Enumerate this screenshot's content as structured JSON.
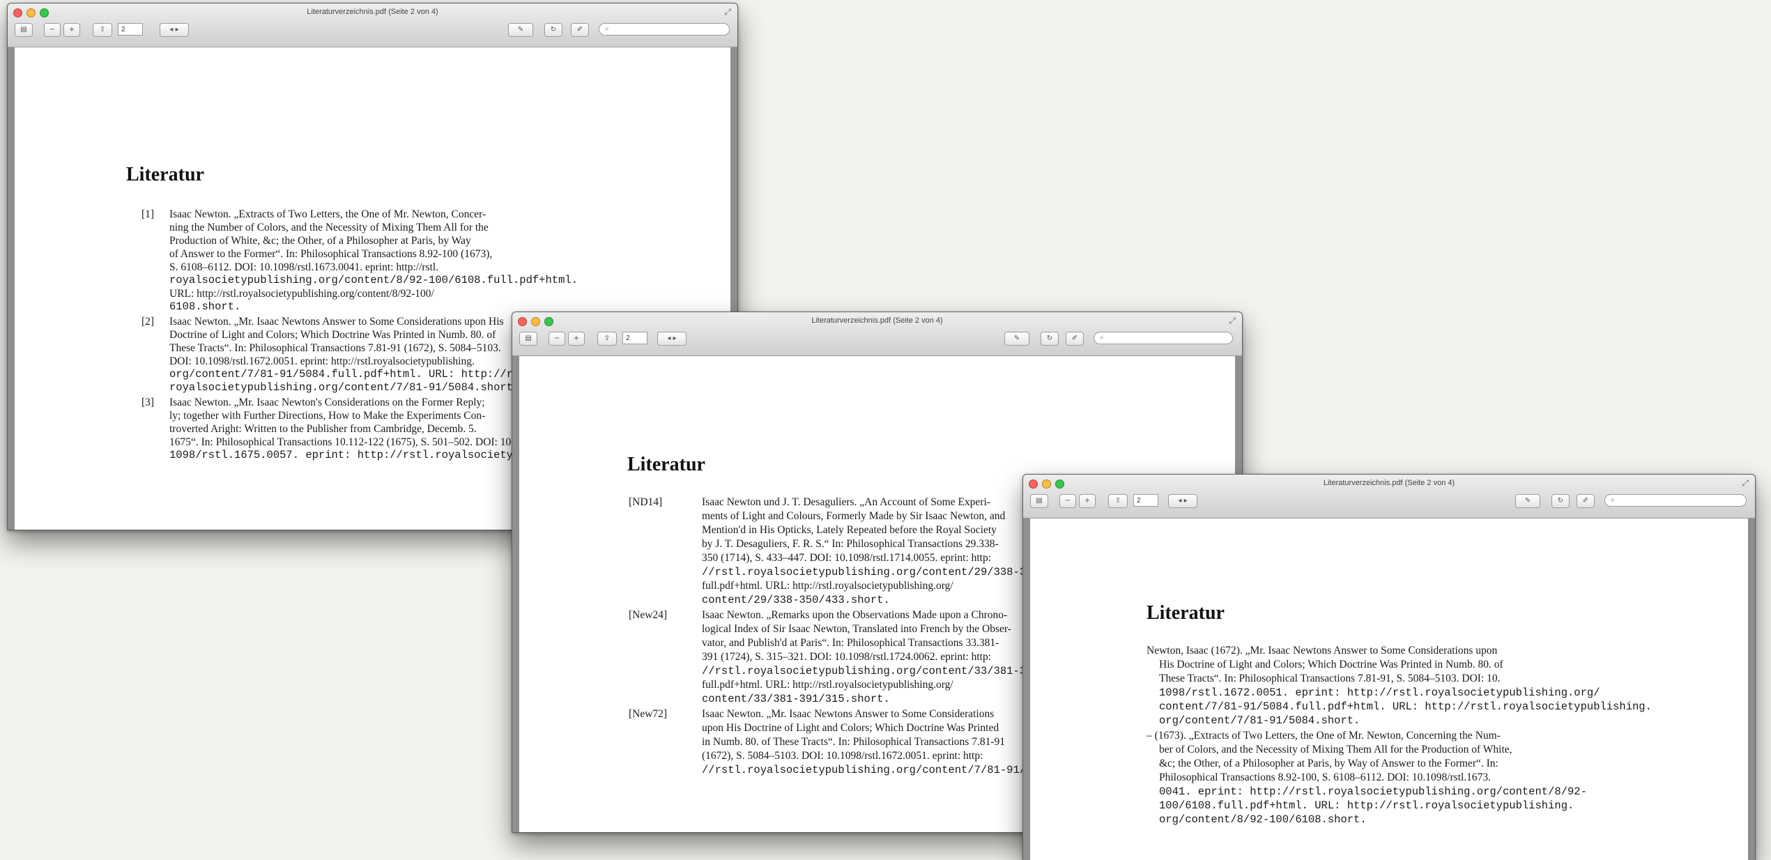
{
  "windows": [
    {
      "title": "Literaturverzeichnis.pdf (Seite 2 von 4)",
      "page_number": "2",
      "heading": "Literatur",
      "entries": [
        {
          "label": "[1]",
          "lines": [
            "Isaac Newton. „Extracts of Two Letters, the One of Mr. Newton, Concer-",
            "ning the Number of Colors, and the Necessity of Mixing Them All for the",
            "Production of White, &c; the Other, of a Philosopher at Paris, by Way",
            "of Answer to the Former“. In: Philosophical Transactions 8.92-100 (1673),",
            "S. 6108–6112. DOI: 10.1098/rstl.1673.0041. eprint: http://rstl.",
            "royalsocietypublishing.org/content/8/92-100/6108.full.pdf+html.",
            "URL: http://rstl.royalsocietypublishing.org/content/8/92-100/",
            "6108.short."
          ]
        },
        {
          "label": "[2]",
          "lines": [
            "Isaac Newton. „Mr. Isaac Newtons Answer to Some Considerations upon His",
            "Doctrine of Light and Colors; Which Doctrine Was Printed in Numb. 80. of",
            "These Tracts“. In: Philosophical Transactions 7.81-91 (1672), S. 5084–5103.",
            "DOI: 10.1098/rstl.1672.0051. eprint: http://rstl.royalsocietypublishing.",
            "org/content/7/81-91/5084.full.pdf+html. URL: http://rstl.",
            "royalsocietypublishing.org/content/7/81-91/5084.short."
          ]
        },
        {
          "label": "[3]",
          "lines": [
            "Isaac Newton. „Mr. Isaac Newton's Considerations on the Former Reply;",
            "ly; together with Further Directions, How to Make the Experiments Con-",
            "troverted Aright: Written to the Publisher from Cambridge, Decemb. 5.",
            "1675“. In: Philosophical Transactions 10.112-122 (1675), S. 501–502. DOI: 10.",
            "1098/rstl.1675.0057. eprint: http://rstl.royalsocietypublishing."
          ]
        }
      ]
    },
    {
      "title": "Literaturverzeichnis.pdf (Seite 2 von 4)",
      "page_number": "2",
      "heading": "Literatur",
      "entries": [
        {
          "label": "[ND14]",
          "lines": [
            "Isaac Newton und J. T. Desaguliers. „An Account of Some Experi-",
            "ments of Light and Colours, Formerly Made by Sir Isaac Newton, and",
            "Mention'd in His Opticks, Lately Repeated before the Royal Society",
            "by J. T. Desaguliers, F. R. S.“ In: Philosophical Transactions 29.338-",
            "350 (1714), S. 433–447. DOI: 10.1098/rstl.1714.0055. eprint: http:",
            "//rstl.royalsocietypublishing.org/content/29/338-350/433.",
            "full.pdf+html. URL: http://rstl.royalsocietypublishing.org/",
            "content/29/338-350/433.short."
          ]
        },
        {
          "label": "[New24]",
          "lines": [
            "Isaac Newton. „Remarks upon the Observations Made upon a Chrono-",
            "logical Index of Sir Isaac Newton, Translated into French by the Obser-",
            "vator, and Publish'd at Paris“. In: Philosophical Transactions 33.381-",
            "391 (1724), S. 315–321. DOI: 10.1098/rstl.1724.0062. eprint: http:",
            "//rstl.royalsocietypublishing.org/content/33/381-391/315.",
            "full.pdf+html. URL: http://rstl.royalsocietypublishing.org/",
            "content/33/381-391/315.short."
          ]
        },
        {
          "label": "[New72]",
          "lines": [
            "Isaac Newton. „Mr. Isaac Newtons Answer to Some Considerations",
            "upon His Doctrine of Light and Colors; Which Doctrine Was Printed",
            "in Numb. 80. of These Tracts“. In: Philosophical Transactions 7.81-91",
            "(1672), S. 5084–5103. DOI: 10.1098/rstl.1672.0051. eprint: http:",
            "//rstl.royalsocietypublishing.org/content/7/81-91/5084."
          ]
        }
      ]
    },
    {
      "title": "Literaturverzeichnis.pdf (Seite 2 von 4)",
      "page_number": "2",
      "heading": "Literatur",
      "entries": [
        {
          "label": "",
          "lines": [
            "Newton, Isaac (1672). „Mr. Isaac Newtons Answer to Some Considerations upon",
            "His Doctrine of Light and Colors; Which Doctrine Was Printed in Numb. 80. of",
            "These Tracts“. In: Philosophical Transactions 7.81-91, S. 5084–5103. DOI: 10.",
            "1098/rstl.1672.0051. eprint: http://rstl.royalsocietypublishing.org/",
            "content/7/81-91/5084.full.pdf+html. URL: http://rstl.royalsocietypublishing.",
            "org/content/7/81-91/5084.short."
          ]
        },
        {
          "label": "",
          "lines": [
            "– (1673). „Extracts of Two Letters, the One of Mr. Newton, Concerning the Num-",
            "ber of Colors, and the Necessity of Mixing Them All for the Production of White,",
            "&c; the Other, of a Philosopher at Paris, by Way of Answer to the Former“. In:",
            "Philosophical Transactions 8.92-100, S. 6108–6112. DOI: 10.1098/rstl.1673.",
            "0041. eprint: http://rstl.royalsocietypublishing.org/content/8/92-",
            "100/6108.full.pdf+html. URL: http://rstl.royalsocietypublishing.",
            "org/content/8/92-100/6108.short."
          ]
        }
      ]
    }
  ],
  "icons": {
    "sidebar": "sidebar-icon",
    "zoom_out": "zoom-out-icon",
    "zoom_in": "zoom-in-icon",
    "share": "share-icon",
    "prev_next": "prev-next-icon",
    "annotate": "pencil-icon",
    "rotate": "rotate-icon",
    "edit": "edit-icon",
    "search": "search-icon",
    "fullscreen": "fullscreen-icon"
  },
  "colors": {
    "desktop": "#f3f2ee",
    "window_chrome": "#8d8d8d",
    "traffic_red": "#fc615d",
    "traffic_yellow": "#fdbc40",
    "traffic_green": "#34c84a"
  }
}
